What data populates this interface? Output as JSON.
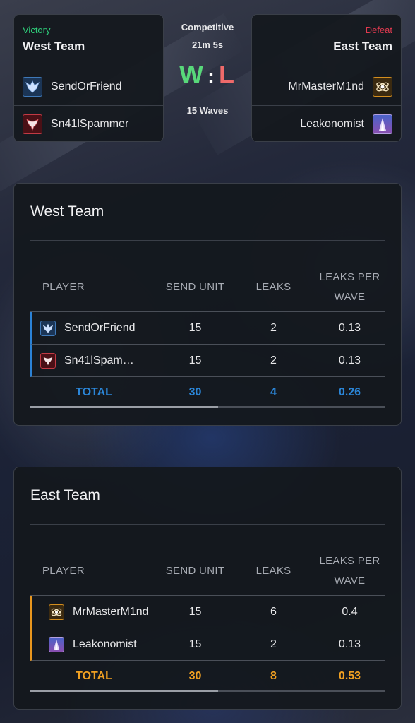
{
  "header": {
    "mode": "Competitive",
    "duration": "21m 5s",
    "score_left": "W",
    "score_sep": ":",
    "score_right": "L",
    "waves": "15 Waves"
  },
  "west_team": {
    "result": "Victory",
    "name": "West Team",
    "players": [
      {
        "name": "SendOrFriend",
        "icon": "winged-crest-icon"
      },
      {
        "name": "Sn41lSpammer",
        "icon": "demon-crest-icon"
      }
    ]
  },
  "east_team": {
    "result": "Defeat",
    "name": "East Team",
    "players": [
      {
        "name": "MrMasterM1nd",
        "icon": "orbit-atom-icon"
      },
      {
        "name": "Leakonomist",
        "icon": "light-pillar-icon"
      }
    ]
  },
  "table_headers": {
    "player": "PLAYER",
    "send_unit": "SEND UNIT",
    "leaks": "LEAKS",
    "leaks_per_wave_1": "LEAKS PER",
    "leaks_per_wave_2": "WAVE"
  },
  "west_stats": {
    "title": "West Team",
    "rows": [
      {
        "player": "SendOrFriend",
        "send_unit": "15",
        "leaks": "2",
        "leaks_per_wave": "0.13"
      },
      {
        "player": "Sn41lSpammer",
        "send_unit": "15",
        "leaks": "2",
        "leaks_per_wave": "0.13"
      }
    ],
    "total": {
      "label": "TOTAL",
      "send_unit": "30",
      "leaks": "4",
      "leaks_per_wave": "0.26"
    }
  },
  "east_stats": {
    "title": "East Team",
    "rows": [
      {
        "player": "MrMasterM1nd",
        "send_unit": "15",
        "leaks": "6",
        "leaks_per_wave": "0.4"
      },
      {
        "player": "Leakonomist",
        "send_unit": "15",
        "leaks": "2",
        "leaks_per_wave": "0.13"
      }
    ],
    "total": {
      "label": "TOTAL",
      "send_unit": "30",
      "leaks": "8",
      "leaks_per_wave": "0.53"
    }
  },
  "colors": {
    "victory": "#2ecf7a",
    "defeat": "#e23a50",
    "west_accent": "#2b86d8",
    "east_accent": "#f0a022",
    "win_letter": "#58d87a",
    "loss_letter": "#ef6a6a"
  }
}
